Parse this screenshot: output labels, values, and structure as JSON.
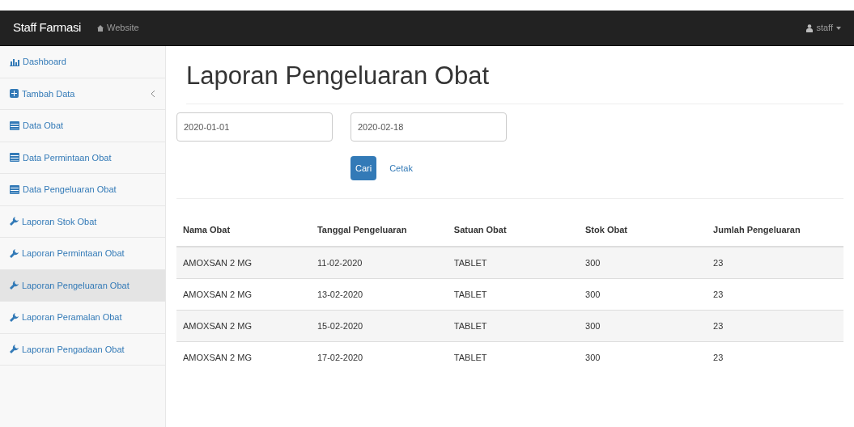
{
  "navbar": {
    "brand": "Staff Farmasi",
    "website_link": "Website",
    "user": "staff"
  },
  "sidebar": {
    "items": [
      {
        "label": "Dashboard",
        "kind": "chart",
        "selected": false,
        "has_submenu": false
      },
      {
        "label": "Tambah Data",
        "kind": "plus",
        "selected": false,
        "has_submenu": true
      },
      {
        "label": "Data Obat",
        "kind": "table",
        "selected": false,
        "has_submenu": false
      },
      {
        "label": "Data Permintaan Obat",
        "kind": "table",
        "selected": false,
        "has_submenu": false
      },
      {
        "label": "Data Pengeluaran Obat",
        "kind": "table",
        "selected": false,
        "has_submenu": false
      },
      {
        "label": "Laporan Stok Obat",
        "kind": "wrench",
        "selected": false,
        "has_submenu": false
      },
      {
        "label": "Laporan Permintaan Obat",
        "kind": "wrench",
        "selected": false,
        "has_submenu": false
      },
      {
        "label": "Laporan Pengeluaran Obat",
        "kind": "wrench",
        "selected": true,
        "has_submenu": false
      },
      {
        "label": "Laporan Peramalan Obat",
        "kind": "wrench",
        "selected": false,
        "has_submenu": false
      },
      {
        "label": "Laporan Pengadaan Obat",
        "kind": "wrench",
        "selected": false,
        "has_submenu": false
      }
    ]
  },
  "page_title": "Laporan Pengeluaran Obat",
  "filter": {
    "start_date": "2020-01-01",
    "end_date": "2020-02-18",
    "search_button": "Cari",
    "print_link": "Cetak"
  },
  "table": {
    "columns": [
      "Nama Obat",
      "Tanggal Pengeluaran",
      "Satuan Obat",
      "Stok Obat",
      "Jumlah Pengeluaran"
    ],
    "rows": [
      [
        "AMOXSAN 2 MG",
        "11-02-2020",
        "TABLET",
        "300",
        "23"
      ],
      [
        "AMOXSAN 2 MG",
        "13-02-2020",
        "TABLET",
        "300",
        "23"
      ],
      [
        "AMOXSAN 2 MG",
        "15-02-2020",
        "TABLET",
        "300",
        "23"
      ],
      [
        "AMOXSAN 2 MG",
        "17-02-2020",
        "TABLET",
        "300",
        "23"
      ]
    ]
  }
}
